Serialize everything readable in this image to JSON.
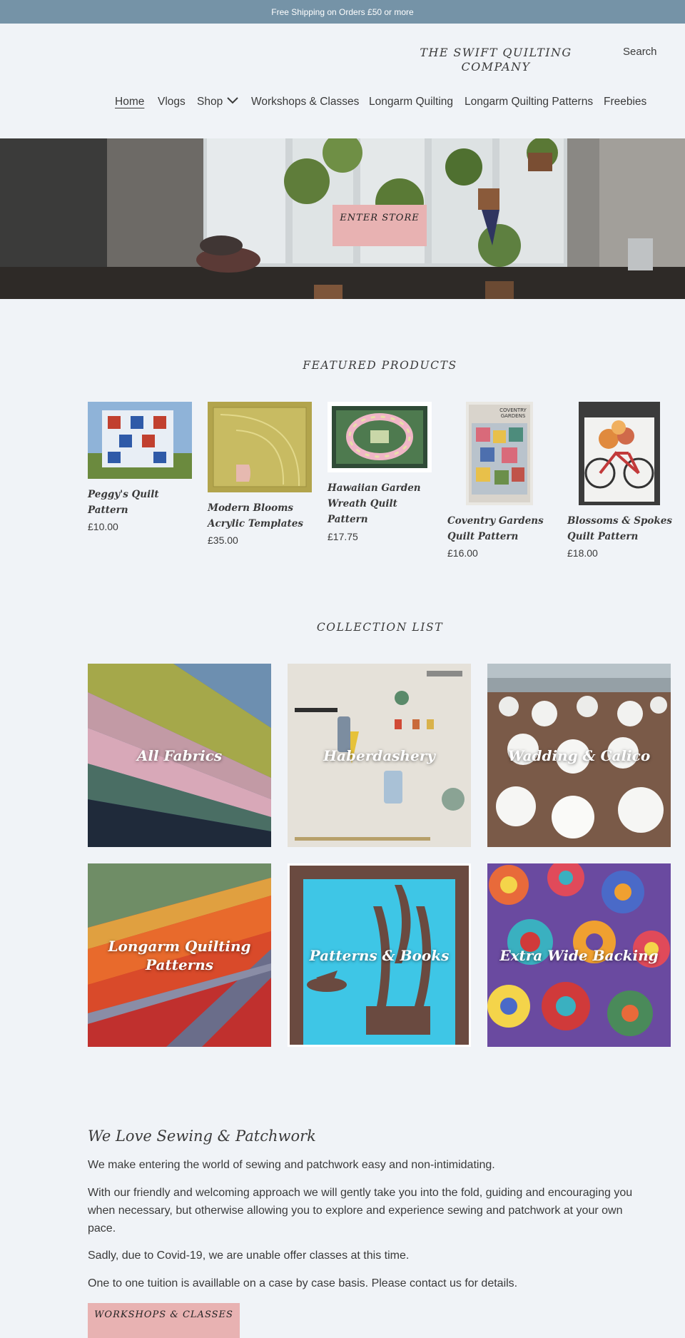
{
  "announcement": "Free Shipping on Orders £50 or more",
  "header": {
    "logo": "THE SWIFT QUILTING COMPANY",
    "search_label": "Search"
  },
  "nav": {
    "items": [
      "Home",
      "Vlogs",
      "Shop",
      "Workshops & Classes",
      "Longarm Quilting",
      "Longarm Quilting Patterns",
      "Freebies"
    ],
    "active": "Home"
  },
  "hero": {
    "button_label": "ENTER STORE"
  },
  "featured": {
    "title": "FEATURED PRODUCTS",
    "products": [
      {
        "name": "Peggy's Quilt Pattern",
        "price": "£10.00"
      },
      {
        "name": "Modern Blooms Acrylic Templates",
        "price": "£35.00"
      },
      {
        "name": "Hawaiian Garden Wreath Quilt Pattern",
        "price": "£17.75"
      },
      {
        "name": "Coventry Gardens Quilt Pattern",
        "price": "£16.00"
      },
      {
        "name": "Blossoms & Spokes Quilt Pattern",
        "price": "£18.00"
      }
    ]
  },
  "collections": {
    "title": "COLLECTION LIST",
    "items": [
      {
        "title": "All Fabrics"
      },
      {
        "title": "Haberdashery"
      },
      {
        "title": "Wadding & Calico"
      },
      {
        "title": "Longarm Quilting Patterns"
      },
      {
        "title": "Patterns & Books"
      },
      {
        "title": "Extra Wide Backing"
      }
    ]
  },
  "about": {
    "heading": "We Love Sewing & Patchwork",
    "paragraphs": [
      "We make entering the world of sewing and patchwork easy and non-intimidating.",
      "With our friendly and welcoming approach we will gently take you into the fold, guiding and encouraging you when necessary, but otherwise allowing you to explore and experience sewing and patchwork at your own pace.",
      "Sadly, due to Covid-19, we are unable offer classes at this time.",
      "One to one tuition is availlable on a case by case basis. Please contact us for details."
    ],
    "button_label": "WORKSHOPS & CLASSES"
  },
  "colors": {
    "announcement_bg": "#7593a7",
    "page_bg": "#f0f3f7",
    "button_bg": "#e8b2b2",
    "text": "#3a3a3a"
  }
}
